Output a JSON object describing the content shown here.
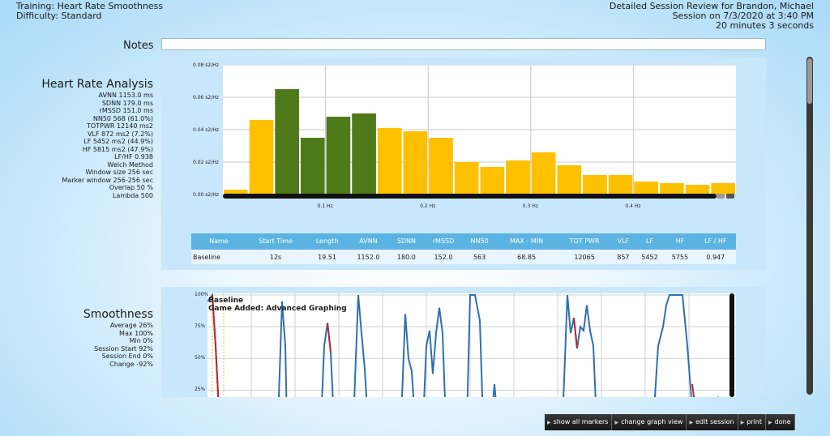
{
  "header": {
    "training": "Training: Heart Rate Smoothness",
    "difficulty": "Difficulty: Standard",
    "review_title": "Detailed Session Review for Brandon, Michael",
    "session_date": "Session on 7/3/2020 at 3:40 PM",
    "duration": "20 minutes 3 seconds"
  },
  "notes": {
    "label": "Notes",
    "value": ""
  },
  "hr_analysis": {
    "title": "Heart Rate Analysis",
    "stats": [
      "AVNN 1153.0 ms",
      "SDNN 179.0 ms",
      "rMSSD 151.0 ms",
      "NN50 568 (61.0%)",
      "TOTPWR 12140 ms2",
      "VLF 872 ms2 (7.2%)",
      "LF 5452 ms2 (44.9%)",
      "HF 5815 ms2 (47.9%)",
      "LF/HF 0.938",
      "Welch Method",
      "Window size 256 sec",
      "Marker window 256-256 sec",
      "Overlap 50 %",
      "Lambda 500"
    ]
  },
  "chart_data": {
    "type": "bar",
    "ylabels": [
      "0.08 s2/Hz",
      "0.06 s2/Hz",
      "0.04 s2/Hz",
      "0.02 s2/Hz",
      "0.00 s2/Hz"
    ],
    "xlabels": [
      "0.1 Hz",
      "0.2 Hz",
      "0.3 Hz",
      "0.4 Hz"
    ],
    "xlim": [
      0,
      0.5
    ],
    "ylim": [
      0,
      0.08
    ],
    "bar_colors": {
      "green": "#4e7a1a",
      "yellow": "#ffc000"
    },
    "bars": [
      {
        "value": 0.003,
        "color": "yellow"
      },
      {
        "value": 0.046,
        "color": "yellow"
      },
      {
        "value": 0.065,
        "color": "green"
      },
      {
        "value": 0.035,
        "color": "green"
      },
      {
        "value": 0.048,
        "color": "green"
      },
      {
        "value": 0.05,
        "color": "green"
      },
      {
        "value": 0.041,
        "color": "yellow"
      },
      {
        "value": 0.039,
        "color": "yellow"
      },
      {
        "value": 0.035,
        "color": "yellow"
      },
      {
        "value": 0.02,
        "color": "yellow"
      },
      {
        "value": 0.017,
        "color": "yellow"
      },
      {
        "value": 0.021,
        "color": "yellow"
      },
      {
        "value": 0.026,
        "color": "yellow"
      },
      {
        "value": 0.018,
        "color": "yellow"
      },
      {
        "value": 0.012,
        "color": "yellow"
      },
      {
        "value": 0.012,
        "color": "yellow"
      },
      {
        "value": 0.008,
        "color": "yellow"
      },
      {
        "value": 0.007,
        "color": "yellow"
      },
      {
        "value": 0.006,
        "color": "yellow"
      },
      {
        "value": 0.007,
        "color": "yellow"
      }
    ]
  },
  "table": {
    "headers": [
      "Name",
      "Start Time",
      "Length",
      "AVNN",
      "SDNN",
      "rMSSD",
      "NN50",
      "MAX - MIN",
      "TOT PWR",
      "VLF",
      "LF",
      "HF",
      "LF / HF"
    ],
    "rows": [
      [
        "Baseline",
        "12s",
        "19.51",
        "1152.0",
        "180.0",
        "152.0",
        "563",
        "68.85",
        "12065",
        "857",
        "5452",
        "5755",
        "0.947"
      ]
    ]
  },
  "smoothness": {
    "title": "Smoothness",
    "stats": [
      "Average 26%",
      "Max 100%",
      "Min 0%",
      "Session Start 92%",
      "Session End 0%",
      "Change -92%"
    ],
    "ylabels": [
      "100%",
      "75%",
      "50%",
      "25%"
    ],
    "annotations": [
      "Baseline",
      "Game Added: Advanced Graphing"
    ]
  },
  "buttons": [
    "show all markers",
    "change graph view",
    "edit session",
    "print",
    "done"
  ]
}
